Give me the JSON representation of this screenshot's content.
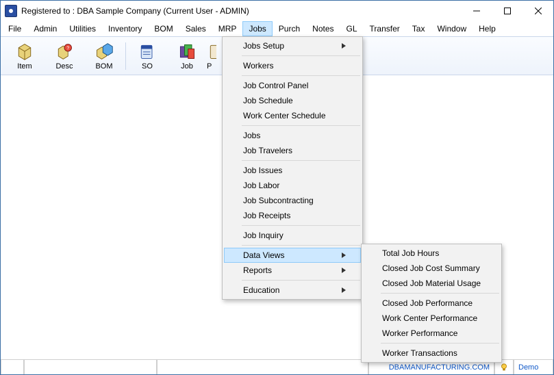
{
  "title": "Registered to : DBA Sample Company (Current User - ADMIN)",
  "menubar": {
    "file": "File",
    "admin": "Admin",
    "utilities": "Utilities",
    "inventory": "Inventory",
    "bom": "BOM",
    "sales": "Sales",
    "mrp": "MRP",
    "jobs": "Jobs",
    "purch": "Purch",
    "notes": "Notes",
    "gl": "GL",
    "transfer": "Transfer",
    "tax": "Tax",
    "window_": "Window",
    "help": "Help"
  },
  "toolbar": {
    "item": "Item",
    "desc": "Desc",
    "bom": "BOM",
    "so": "SO",
    "job": "Job",
    "p": "P"
  },
  "jobs_menu": {
    "setup": "Jobs Setup",
    "workers": "Workers",
    "control_panel": "Job Control Panel",
    "schedule": "Job Schedule",
    "wc_schedule": "Work Center Schedule",
    "jobs": "Jobs",
    "travelers": "Job Travelers",
    "issues": "Job Issues",
    "labor": "Job Labor",
    "subcontracting": "Job Subcontracting",
    "receipts": "Job Receipts",
    "inquiry": "Job Inquiry",
    "data_views": "Data Views",
    "reports": "Reports",
    "education": "Education"
  },
  "data_views_submenu": {
    "total_hours": "Total Job Hours",
    "closed_cost": "Closed Job Cost Summary",
    "closed_material": "Closed Job Material Usage",
    "closed_perf": "Closed Job Performance",
    "wc_perf": "Work Center Performance",
    "worker_perf": "Worker Performance",
    "worker_trans": "Worker Transactions"
  },
  "status": {
    "url": "DBAMANUFACTURING.COM",
    "demo": "Demo"
  }
}
